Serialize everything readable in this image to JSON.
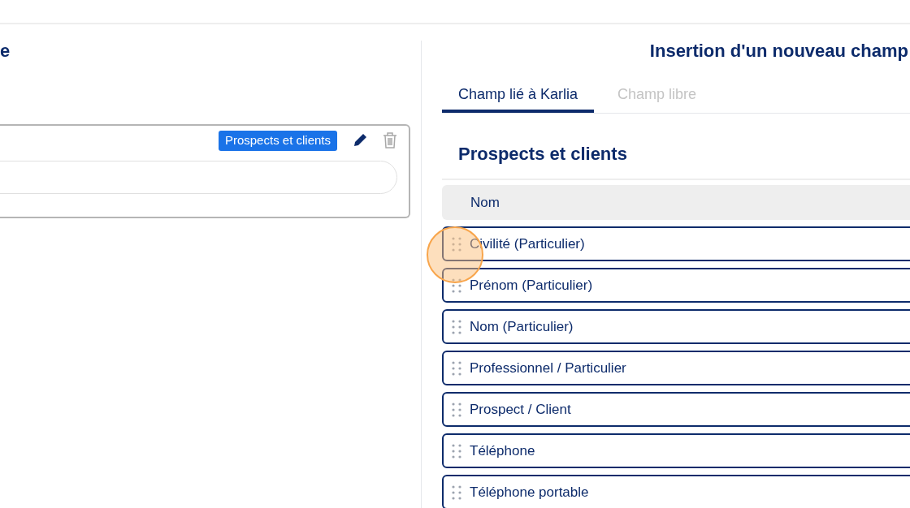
{
  "left_panel": {
    "title": "e",
    "card": {
      "badge": "Prospects et clients"
    }
  },
  "dialog": {
    "title": "Insertion d'un nouveau champ",
    "tabs": [
      {
        "label": "Champ lié à Karlia",
        "selected": true
      },
      {
        "label": "Champ libre",
        "selected": false
      }
    ],
    "section_title": "Prospects et clients",
    "fields": [
      {
        "label": "Nom",
        "disabled": true
      },
      {
        "label": "Civilité (Particulier)",
        "disabled": false
      },
      {
        "label": "Prénom (Particulier)",
        "disabled": false
      },
      {
        "label": "Nom (Particulier)",
        "disabled": false
      },
      {
        "label": "Professionnel / Particulier",
        "disabled": false
      },
      {
        "label": "Prospect / Client",
        "disabled": false
      },
      {
        "label": "Téléphone",
        "disabled": false
      },
      {
        "label": "Téléphone portable",
        "disabled": false
      }
    ]
  }
}
